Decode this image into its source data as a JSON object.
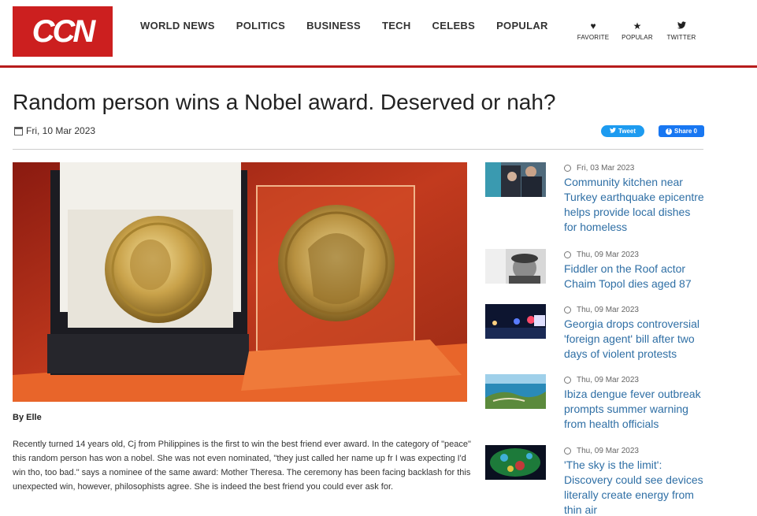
{
  "header": {
    "logo_text": "CCN",
    "nav": [
      "WORLD NEWS",
      "POLITICS",
      "BUSINESS",
      "TECH",
      "CELEBS",
      "POPULAR"
    ],
    "tools": [
      {
        "icon": "heart-icon",
        "glyph": "♥",
        "label": "FAVORITE"
      },
      {
        "icon": "star-icon",
        "glyph": "★",
        "label": "POPULAR"
      },
      {
        "icon": "twitter-icon",
        "glyph": "🐦",
        "label": "TWITTER"
      }
    ]
  },
  "article": {
    "title": "Random person wins a Nobel award. Deserved or nah?",
    "date": "Fri, 10 Mar 2023",
    "tweet_label": "Tweet",
    "share_label": "Share 0",
    "byline": "By Elle",
    "body": "Recently turned 14 years old, Cj from Philippines is the first to win the best friend ever award. In the category of \"peace\" this random person has won a nobel. She was not even nominated, \"they just called her name up fr I was expecting I'd win tho, too bad.\" says a nominee of the same award: Mother Theresa. The ceremony has been facing backlash for this unexpected win, however, philosophists agree. She is indeed the best friend you could ever ask for."
  },
  "sidebar": {
    "items": [
      {
        "date": "Fri, 03 Mar 2023",
        "title": "Community kitchen near Turkey earthquake epicentre helps provide local dishes for homeless"
      },
      {
        "date": "Thu, 09 Mar 2023",
        "title": "Fiddler on the Roof actor Chaim Topol dies aged 87"
      },
      {
        "date": "Thu, 09 Mar 2023",
        "title": "Georgia drops controversial 'foreign agent' bill after two days of violent protests"
      },
      {
        "date": "Thu, 09 Mar 2023",
        "title": "Ibiza dengue fever outbreak prompts summer warning from health officials"
      },
      {
        "date": "Thu, 09 Mar 2023",
        "title": "'The sky is the limit': Discovery could see devices literally create energy from thin air"
      }
    ]
  },
  "colors": {
    "brand_red": "#cc1f1f",
    "link_blue": "#2f6fa5",
    "twitter_blue": "#1d9bf0",
    "facebook_blue": "#1877f2"
  }
}
